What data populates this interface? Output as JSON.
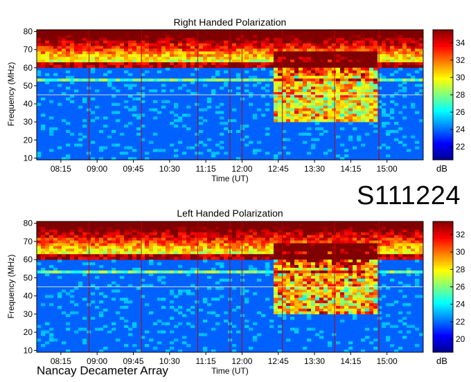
{
  "station": "Nancay Decameter Array",
  "observation_id": "S111224",
  "chart_data": [
    {
      "type": "heatmap",
      "title": "Right Handed Polarization",
      "xlabel": "Time (UT)",
      "ylabel": "Frequency (MHz)",
      "x_ticks": [
        "08:15",
        "09:00",
        "09:45",
        "10:30",
        "11:15",
        "12:00",
        "12:45",
        "13:30",
        "14:15",
        "15:00"
      ],
      "x_range": [
        "07:45",
        "15:45"
      ],
      "y_ticks": [
        10,
        20,
        30,
        40,
        50,
        60,
        70,
        80
      ],
      "ylim": [
        9,
        81
      ],
      "colorbar": {
        "label": "dB",
        "ticks": [
          22,
          24,
          26,
          28,
          30,
          32,
          34
        ],
        "range": [
          20.5,
          35.5
        ]
      },
      "colormap": [
        "#00008f",
        "#0000ff",
        "#0080ff",
        "#00ffff",
        "#80ff80",
        "#ffff00",
        "#ff8000",
        "#ff0000",
        "#800000"
      ]
    },
    {
      "type": "heatmap",
      "title": "Left Handed Polarization",
      "xlabel": "Time (UT)",
      "ylabel": "Frequency (MHz)",
      "x_ticks": [
        "08:15",
        "09:00",
        "09:45",
        "10:30",
        "11:15",
        "12:00",
        "12:45",
        "13:30",
        "14:15",
        "15:00"
      ],
      "x_range": [
        "07:45",
        "15:45"
      ],
      "y_ticks": [
        10,
        20,
        30,
        40,
        50,
        60,
        70,
        80
      ],
      "ylim": [
        9,
        81
      ],
      "colorbar": {
        "label": "dB",
        "ticks": [
          20,
          22,
          24,
          26,
          28,
          30,
          32
        ],
        "range": [
          18.5,
          33.5
        ]
      },
      "colormap": [
        "#00008f",
        "#0000ff",
        "#0080ff",
        "#00ffff",
        "#80ff80",
        "#ffff00",
        "#ff8000",
        "#ff0000",
        "#800000"
      ]
    }
  ]
}
